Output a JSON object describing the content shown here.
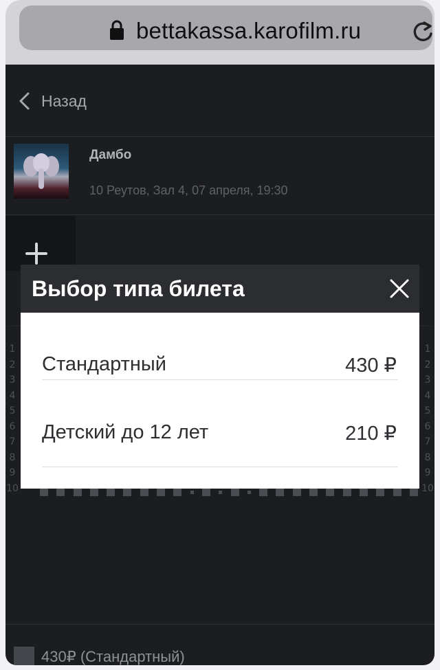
{
  "browser": {
    "url": "bettakassa.karofilm.ru",
    "lock_icon": "lock-icon",
    "reload_icon": "reload-icon"
  },
  "nav": {
    "back_label": "Назад"
  },
  "movie": {
    "title": "Дамбо",
    "details": "10 Реутов, Зал 4, 07 апреля, 19:30"
  },
  "seat_map": {
    "rows": [
      "1",
      "2",
      "3",
      "4",
      "5",
      "6",
      "7",
      "8",
      "9",
      "10"
    ]
  },
  "legend": {
    "label": "430₽ (Стандартный)"
  },
  "modal": {
    "title": "Выбор типа билета",
    "options": [
      {
        "name": "Стандартный",
        "price": "430 ₽"
      },
      {
        "name": "Детский до 12 лет",
        "price": "210 ₽"
      }
    ]
  },
  "colors": {
    "page_background": "#1c1d20",
    "modal_header": "#2c2d31",
    "modal_body": "#ffffff"
  }
}
